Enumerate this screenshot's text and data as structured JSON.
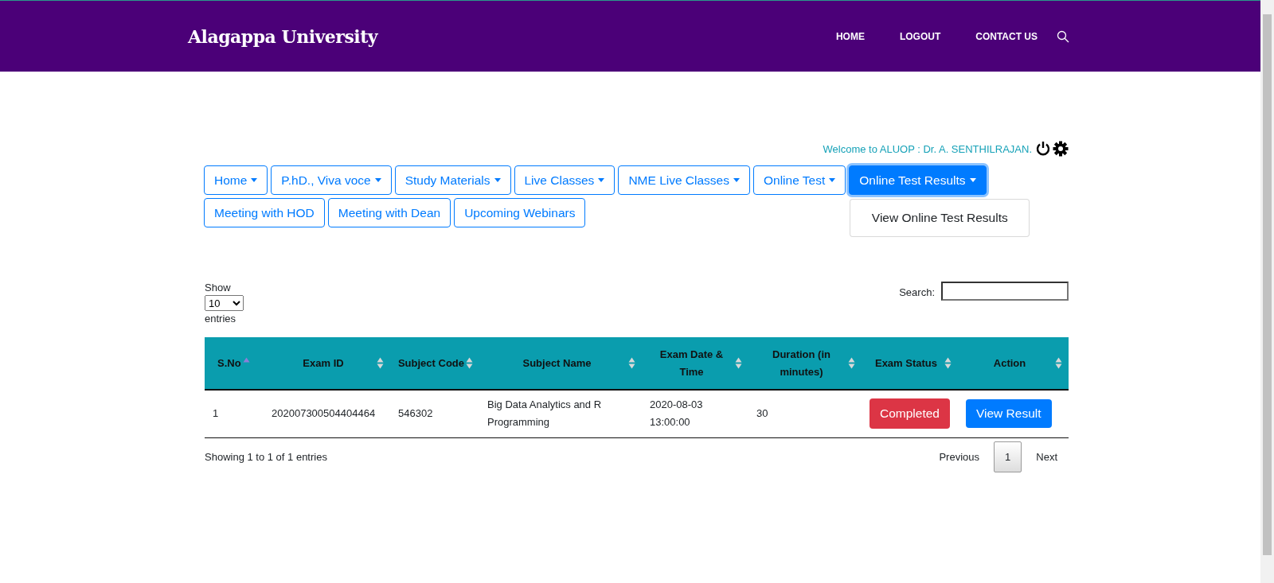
{
  "header": {
    "title": "Alagappa University",
    "nav": [
      "HOME",
      "LOGOUT",
      "CONTACT US"
    ]
  },
  "welcome": "Welcome to ALUOP : Dr. A. SENTHILRAJAN.",
  "menu": [
    {
      "label": "Home",
      "has_menu": true,
      "selected": false
    },
    {
      "label": "P.hD., Viva voce",
      "has_menu": true,
      "selected": false
    },
    {
      "label": "Study Materials",
      "has_menu": true,
      "selected": false
    },
    {
      "label": "Live Classes",
      "has_menu": true,
      "selected": false
    },
    {
      "label": "NME Live Classes",
      "has_menu": true,
      "selected": false
    },
    {
      "label": "Online Test",
      "has_menu": true,
      "selected": false
    },
    {
      "label": "Online Test Results",
      "has_menu": true,
      "selected": true
    },
    {
      "label": "Meeting with HOD",
      "has_menu": false,
      "selected": false
    },
    {
      "label": "Meeting with Dean",
      "has_menu": false,
      "selected": false
    },
    {
      "label": "Upcoming Webinars",
      "has_menu": false,
      "selected": false
    }
  ],
  "dropdown": {
    "items": [
      "View Online Test Results"
    ]
  },
  "length": {
    "before": "Show",
    "value": "10",
    "after": "entries"
  },
  "search": {
    "label": "Search:"
  },
  "table": {
    "columns": [
      {
        "label": "S.No",
        "sorted": true
      },
      {
        "label": "Exam ID",
        "sorted": false
      },
      {
        "label": "Subject Code",
        "sorted": false
      },
      {
        "label": "Subject Name",
        "sorted": false
      },
      {
        "label": "Exam Date & Time",
        "sorted": false
      },
      {
        "label": "Duration (in minutes)",
        "sorted": false
      },
      {
        "label": "Exam Status",
        "sorted": false
      },
      {
        "label": "Action",
        "sorted": false
      }
    ],
    "rows": [
      {
        "sno": "1",
        "exam_id": "202007300504404464",
        "subject_code": "546302",
        "subject_name": "Big Data Analytics and R Programming",
        "date": "2020-08-03 13:00:00",
        "duration": "30",
        "status": {
          "label": "Completed",
          "kind": "danger"
        },
        "action": "View Result"
      }
    ]
  },
  "info": "Showing 1 to 1 of 1 entries",
  "pagination": {
    "previous": "Previous",
    "pages": [
      {
        "label": "1",
        "selected": true
      }
    ],
    "next": "Next"
  }
}
